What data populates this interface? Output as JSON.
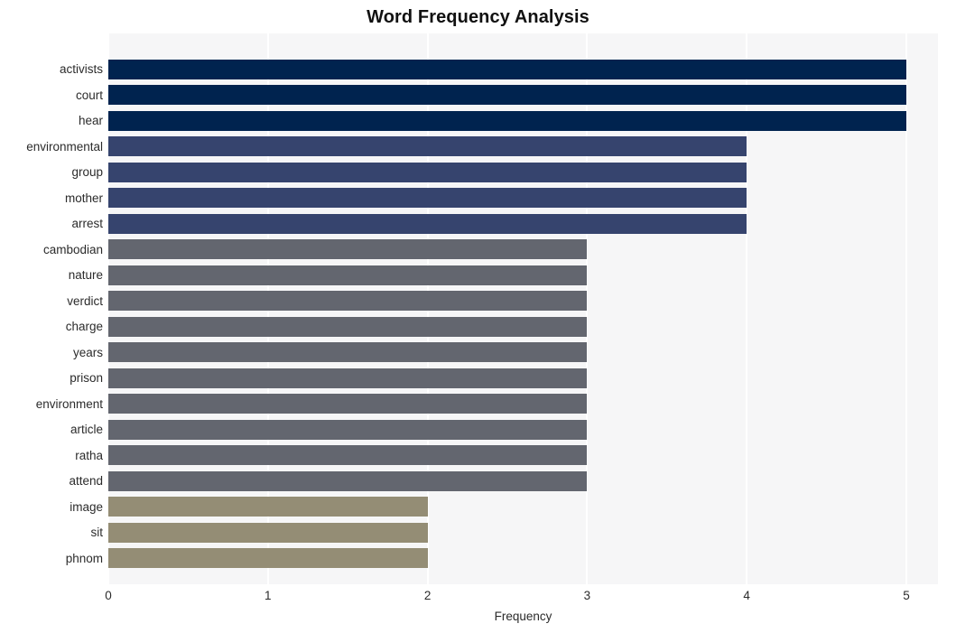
{
  "chart_data": {
    "type": "bar",
    "orientation": "horizontal",
    "title": "Word Frequency Analysis",
    "xlabel": "Frequency",
    "ylabel": "",
    "xlim": [
      0,
      5
    ],
    "xticks": [
      "0",
      "1",
      "2",
      "3",
      "4",
      "5"
    ],
    "grid": true,
    "legend": "none",
    "categories": [
      "activists",
      "court",
      "hear",
      "environmental",
      "group",
      "mother",
      "arrest",
      "cambodian",
      "nature",
      "verdict",
      "charge",
      "years",
      "prison",
      "environment",
      "article",
      "ratha",
      "attend",
      "image",
      "sit",
      "phnom"
    ],
    "values": [
      5,
      5,
      5,
      4,
      4,
      4,
      4,
      3,
      3,
      3,
      3,
      3,
      3,
      3,
      3,
      3,
      3,
      2,
      2,
      2
    ],
    "bar_colors": [
      "#00234f",
      "#00234f",
      "#00234f",
      "#36446e",
      "#36446e",
      "#36446e",
      "#36446e",
      "#63666f",
      "#63666f",
      "#63666f",
      "#63666f",
      "#63666f",
      "#63666f",
      "#63666f",
      "#63666f",
      "#63666f",
      "#63666f",
      "#948d75",
      "#948d75",
      "#948d75"
    ]
  },
  "style": {
    "plot_background": "#f6f6f7",
    "gridline_color": "#ffffff",
    "page_background": "#ffffff",
    "title_color": "#111111",
    "tick_color": "#2b2b2b"
  }
}
